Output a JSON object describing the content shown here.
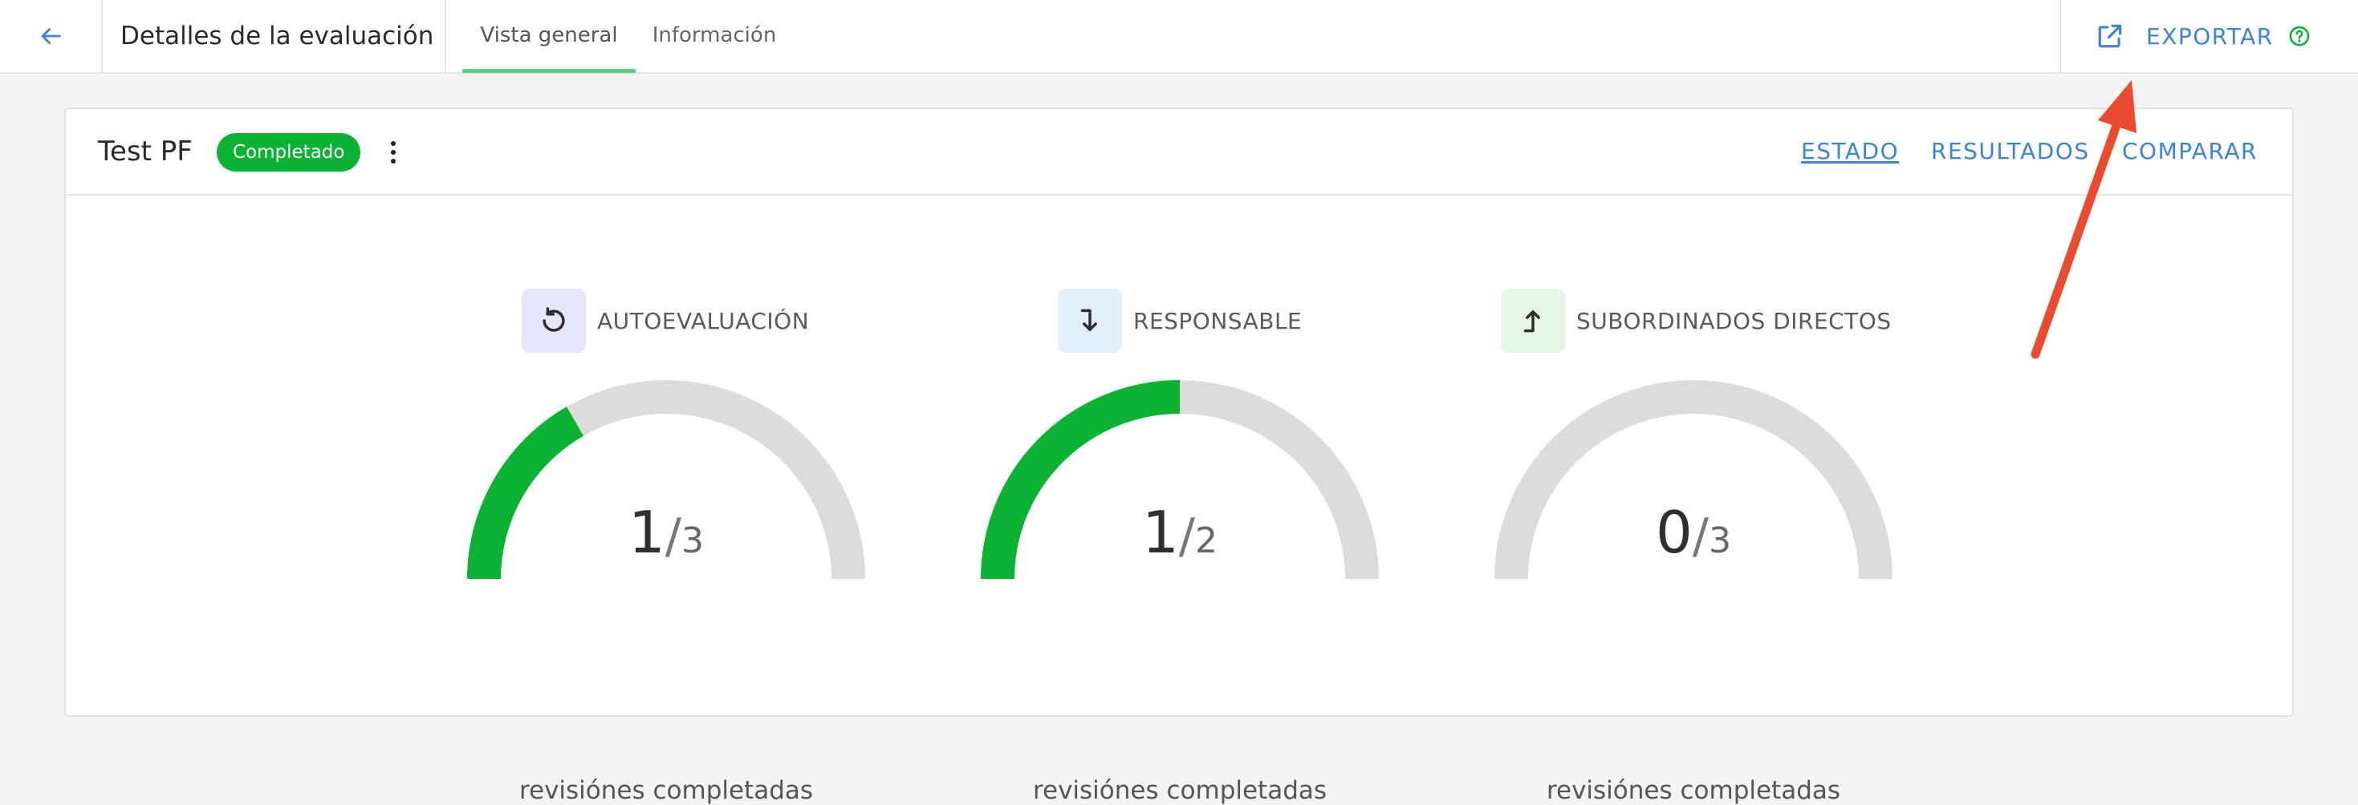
{
  "header": {
    "title": "Detalles de la evaluación",
    "tabs": [
      {
        "label": "Vista general",
        "active": true
      },
      {
        "label": "Información",
        "active": false
      }
    ],
    "export_label": "EXPORTAR"
  },
  "evaluation": {
    "name": "Test PF",
    "status": "Completado",
    "views": [
      {
        "label": "ESTADO",
        "active": true
      },
      {
        "label": "RESULTADOS",
        "active": false
      },
      {
        "label": "COMPARAR",
        "active": false
      }
    ]
  },
  "gauges": [
    {
      "label": "AUTOEVALUACIÓN",
      "completed": "1",
      "slash": "/",
      "total": "3",
      "caption": "revisiónes completadas",
      "icon": "rotate-ccw-icon",
      "icon_bg": "#e6e6fa"
    },
    {
      "label": "RESPONSABLE",
      "completed": "1",
      "slash": "/",
      "total": "2",
      "caption": "revisiónes completadas",
      "icon": "arrow-turn-down-icon",
      "icon_bg": "#e3f0fb"
    },
    {
      "label": "SUBORDINADOS DIRECTOS",
      "completed": "0",
      "slash": "/",
      "total": "3",
      "caption": "revisiónes completadas",
      "icon": "arrow-turn-up-icon",
      "icon_bg": "#e6f6e4"
    }
  ],
  "colors": {
    "accent": "#3d84d6",
    "success": "#0cb233",
    "tab_indicator": "#5ccf7c",
    "gauge_track": "#dcdcdc",
    "annotation_arrow": "#ea4a2e"
  }
}
